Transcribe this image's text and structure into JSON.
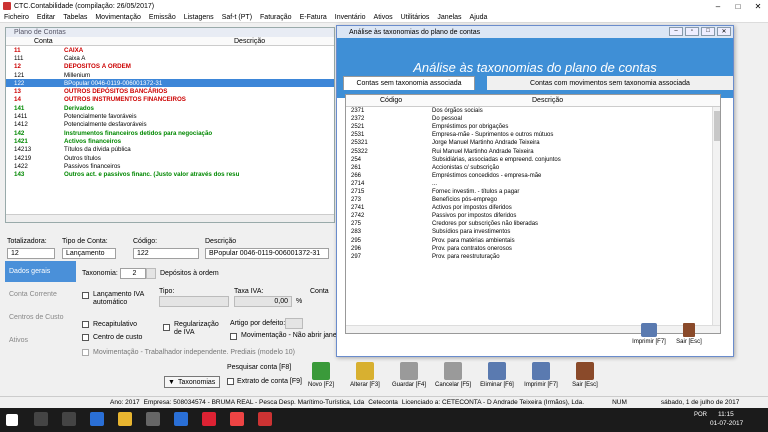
{
  "app": {
    "title": "CTC.Contabilidade (compilação: 26/05/2017)"
  },
  "menu": [
    "Ficheiro",
    "Editar",
    "Tabelas",
    "Movimentação",
    "Emissão",
    "Listagens",
    "Saf-t (PT)",
    "Faturação",
    "E-Fatura",
    "Inventário",
    "Ativos",
    "Utilitários",
    "Janelas",
    "Ajuda"
  ],
  "plano": {
    "title": "Plano de Contas",
    "col_conta": "Conta",
    "col_descricao": "Descrição",
    "rows": [
      {
        "conta": "11",
        "desc": "CAIXA",
        "style": "red"
      },
      {
        "conta": "111",
        "desc": "Caixa A",
        "style": ""
      },
      {
        "conta": "12",
        "desc": "DEPÓSITOS À ORDEM",
        "style": "red"
      },
      {
        "conta": "121",
        "desc": "Millenium",
        "style": ""
      },
      {
        "conta": "122",
        "desc": "BPopular 0046-0119-006001372-31",
        "style": "sel"
      },
      {
        "conta": "13",
        "desc": "OUTROS DEPÓSITOS BANCÁRIOS",
        "style": "red"
      },
      {
        "conta": "14",
        "desc": "OUTROS INSTRUMENTOS FINANCEIROS",
        "style": "red"
      },
      {
        "conta": "141",
        "desc": "Derivados",
        "style": "grn"
      },
      {
        "conta": "1411",
        "desc": "Potencialmente favoráveis",
        "style": ""
      },
      {
        "conta": "1412",
        "desc": "Potencialmente desfavoráveis",
        "style": ""
      },
      {
        "conta": "142",
        "desc": "Instrumentos financeiros detidos para negociação",
        "style": "grn"
      },
      {
        "conta": "1421",
        "desc": "Activos financeiros",
        "style": "grn"
      },
      {
        "conta": "14213",
        "desc": "Títulos da dívida pública",
        "style": ""
      },
      {
        "conta": "14219",
        "desc": "Outros títulos",
        "style": ""
      },
      {
        "conta": "1422",
        "desc": "Passivos financeiros",
        "style": ""
      },
      {
        "conta": "143",
        "desc": "Outros act. e passivos financ. (Justo valor através dos resu",
        "style": "grn"
      }
    ]
  },
  "form": {
    "totalizadora_label": "Totalizadora:",
    "totalizadora_value": "12",
    "tipo_label": "Tipo de Conta:",
    "tipo_value": "Lançamento",
    "codigo_label": "Código:",
    "codigo_value": "122",
    "descricao_label": "Descrição",
    "descricao_value": "BPopular 0046-0119-006001372-31",
    "taxonomia_label": "Taxonomia:",
    "taxonomia_value": "2",
    "taxonomia_desc": "Depósitos à ordem",
    "tipo2_label": "Tipo:",
    "taxa_iva_label": "Taxa IVA:",
    "taxa_iva_value": "0,00",
    "percent": "%",
    "conta_label": "Conta",
    "lanc_iva": "Lançamento IVA automático",
    "recapitulativo": "Recapitulativo",
    "centro_custo": "Centro de custo",
    "regularizacao": "Regularização de IVA",
    "artigo_label": "Artigo por defeito:",
    "movimentacao": "Movimentação - Não abrir jane",
    "mov_trab": "Movimentação - Trabalhador independente. Prediais (modelo 10)",
    "taxonomias_btn": "Taxonomias",
    "pesquisar": "Pesquisar conta [F8]",
    "extrato": "Extrato de conta [F9]"
  },
  "sidetabs": [
    "Dados gerais",
    "Conta Corrente",
    "Centros de Custo",
    "Ativos"
  ],
  "toolbar": [
    {
      "label": "Novo [F2]",
      "icon": "new-icon",
      "color": "#3a9a3a"
    },
    {
      "label": "Alterar [F3]",
      "icon": "edit-icon",
      "color": "#d8b030"
    },
    {
      "label": "Guardar [F4]",
      "icon": "save-icon",
      "color": "#9a9a9a"
    },
    {
      "label": "Cancelar [F5]",
      "icon": "cancel-icon",
      "color": "#9a9a9a"
    },
    {
      "label": "Eliminar [F6]",
      "icon": "delete-icon",
      "color": "#5a7ab0"
    },
    {
      "label": "Imprimir [F7]",
      "icon": "print-icon",
      "color": "#5a7ab0"
    },
    {
      "label": "Sair [Esc]",
      "icon": "exit-icon",
      "color": "#8a4a2a"
    }
  ],
  "dialog": {
    "title": "Análise às taxonomias do plano de contas",
    "banner": "Análise às taxonomias do plano de contas",
    "tab1": "Contas sem taxonomia associada",
    "tab2": "Contas com movimentos sem taxonomia associada",
    "col_codigo": "Código",
    "col_descricao": "Descrição",
    "rows": [
      [
        "2371",
        "Dos órgãos sociais"
      ],
      [
        "2372",
        "Do pessoal"
      ],
      [
        "2521",
        "Empréstimos por obrigações"
      ],
      [
        "2531",
        "Empresa-mãe - Suprimentos e outros mútuos"
      ],
      [
        "25321",
        "Jorge Manuel Martinho Andrade Teixeira"
      ],
      [
        "25322",
        "Rui Manuel Martinho Andrade Teixeira"
      ],
      [
        "254",
        "Subsidiárias, associadas e empreend. conjuntos"
      ],
      [
        "261",
        "Accionistas c/ subscrição"
      ],
      [
        "266",
        "Empréstimos concedidos - empresa-mãe"
      ],
      [
        "2714",
        "..."
      ],
      [
        "2715",
        "Fornec investim. - títulos a pagar"
      ],
      [
        "273",
        "Benefícios pós-emprego"
      ],
      [
        "2741",
        "Activos por impostos diferidos"
      ],
      [
        "2742",
        "Passivos por impostos diferidos"
      ],
      [
        "275",
        "Credores por subscrições não liberadas"
      ],
      [
        "283",
        "Subsídios  para investimentos"
      ],
      [
        "295",
        "Prov. para matérias ambientais"
      ],
      [
        "296",
        "Prov. para contratos onerosos"
      ],
      [
        "297",
        "Prov. para reestruturação"
      ]
    ],
    "print_label": "Imprimir [F7]",
    "exit_label": "Sair [Esc]"
  },
  "status": {
    "ano": "Ano: 2017",
    "empresa": "Empresa: 508034574 - BRUMA REAL - Pesca Desp. Marítimo-Turística, Lda",
    "ceteconta": "Ceteconta",
    "licenciado": "Licenciado a: CETECONTA - D Andrade Teixeira (Irmãos), Lda.",
    "num": "NUM",
    "data": "sábado, 1 de julho de 2017"
  },
  "taskbar": {
    "time": "11:15",
    "date": "01-07-2017",
    "lang": "POR"
  }
}
